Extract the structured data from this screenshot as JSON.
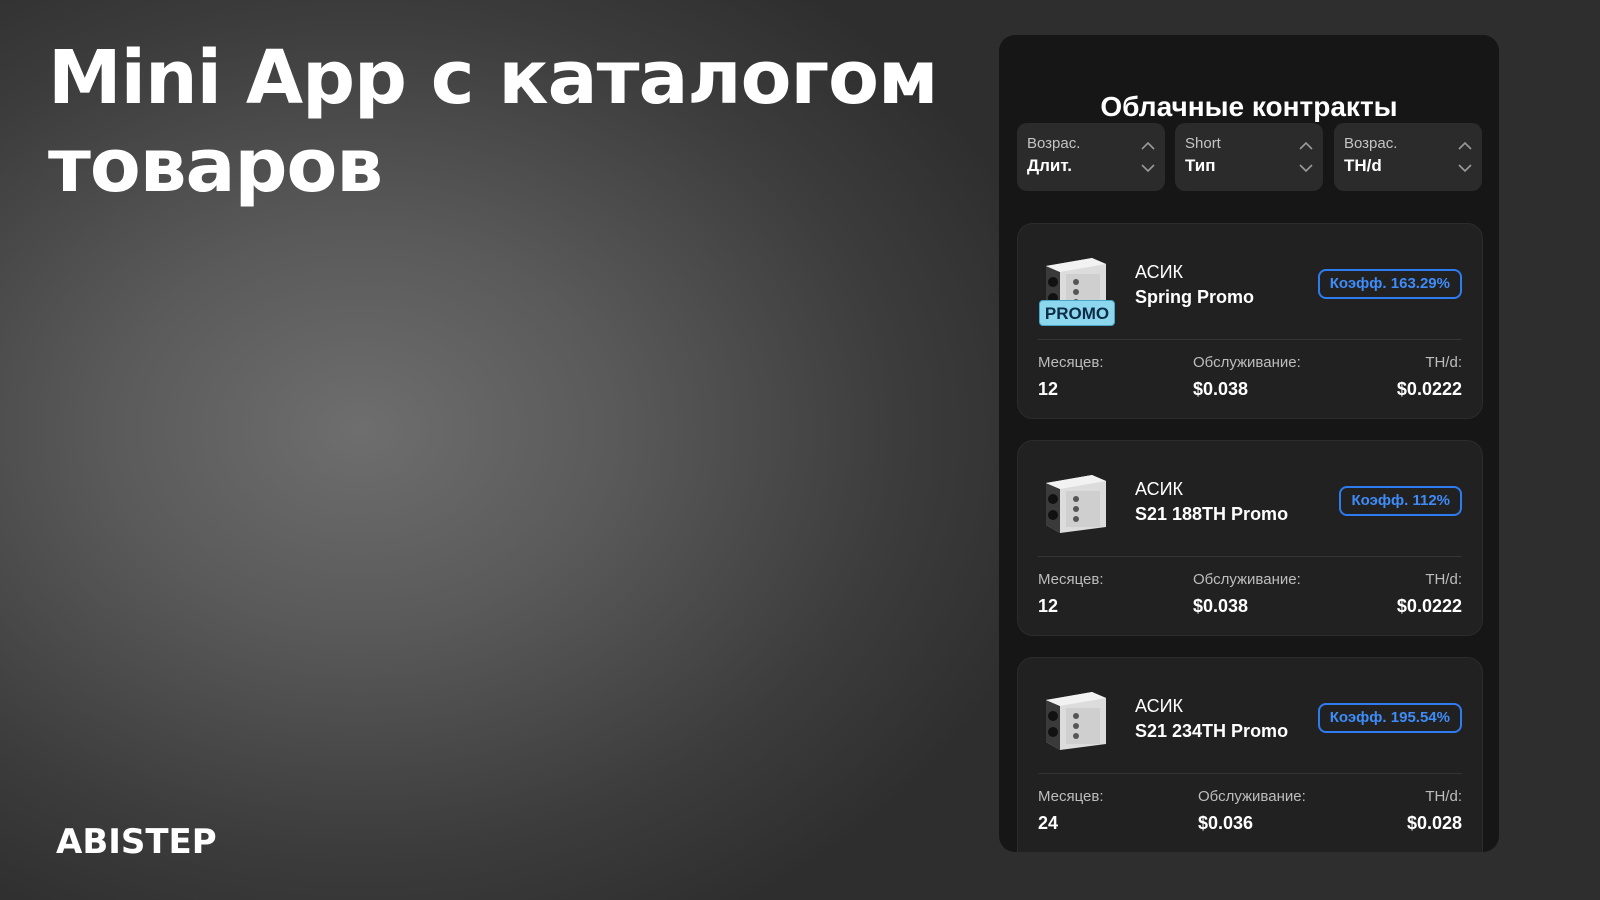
{
  "slide": {
    "headline_line1": "Mini App с каталогом",
    "headline_line2": "товаров",
    "brand": "ABISTEP"
  },
  "app": {
    "title": "Облачные контракты",
    "sorts": [
      {
        "top": "Возрас.",
        "bottom": "Длит."
      },
      {
        "top": "Short",
        "bottom": "Тип"
      },
      {
        "top": "Возрас.",
        "bottom": "TH/d"
      }
    ],
    "cards": [
      {
        "type": "АСИК",
        "name": "Spring Promo",
        "coef": "Коэфф. 163.29%",
        "promo": "PROMO",
        "months_label": "Месяцев:",
        "months": "12",
        "service_label": "Обслуживание:",
        "service": "$0.038",
        "thd_label": "TH/d:",
        "thd": "$0.0222"
      },
      {
        "type": "АСИК",
        "name": "S21 188TH Promo",
        "coef": "Коэфф. 112%",
        "months_label": "Месяцев:",
        "months": "12",
        "service_label": "Обслуживание:",
        "service": "$0.038",
        "thd_label": "TH/d:",
        "thd": "$0.0222"
      },
      {
        "type": "АСИК",
        "name": "S21 234TH Promo",
        "coef": "Коэфф. 195.54%",
        "months_label": "Месяцев:",
        "months": "24",
        "service_label": "Обслуживание:",
        "service": "$0.036",
        "thd_label": "TH/d:",
        "thd": "$0.028"
      }
    ]
  },
  "colors": {
    "accent_blue": "#2e7cf0",
    "promo_badge": "#8cd6ee",
    "panel_bg": "#161616",
    "card_bg": "#212121"
  },
  "icons": {
    "sort": "sort-updown-icon",
    "product": "asic-miner-icon"
  }
}
